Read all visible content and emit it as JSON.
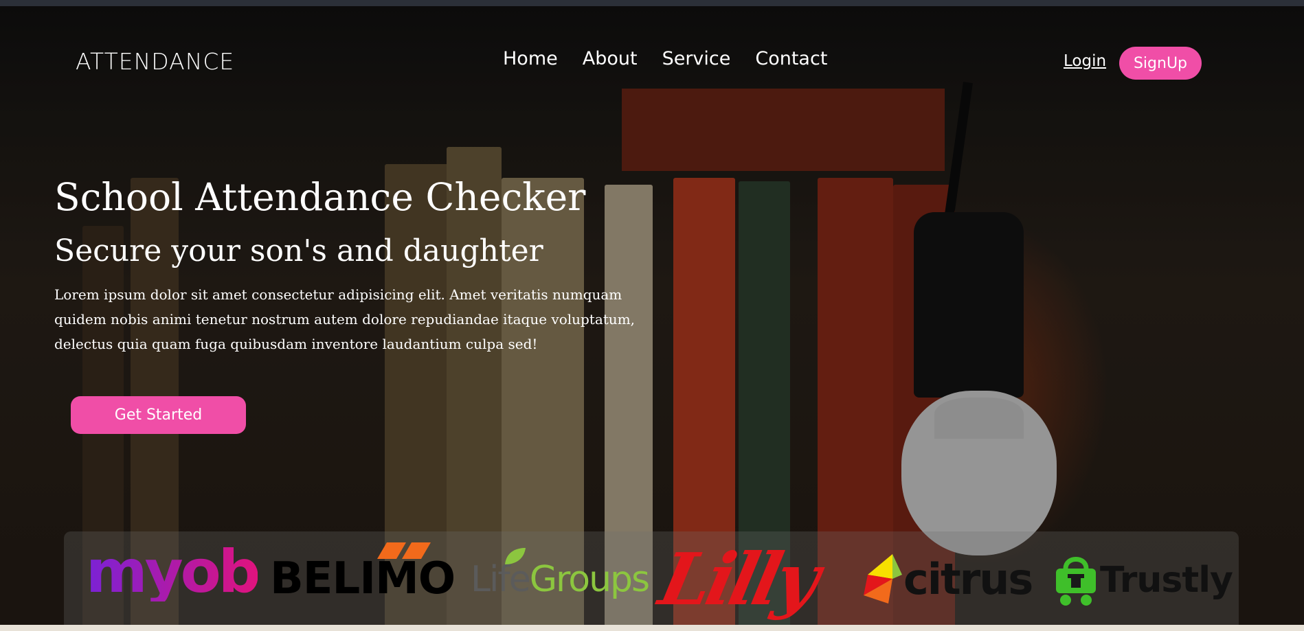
{
  "brand": "ATTENDANCE",
  "nav": {
    "links": [
      "Home",
      "About",
      "Service",
      "Contact"
    ],
    "login": "Login",
    "signup": "SignUp"
  },
  "hero": {
    "title": "School Attendance Checker",
    "subtitle": "Secure your son's and daughter",
    "text": "Lorem ipsum dolor sit amet consectetur adipisicing elit. Amet veritatis numquam quidem nobis animi tenetur nostrum autem dolore repudiandae itaque voluptatum, delectus quia quam fuga quibusdam inventore laudantium culpa sed!",
    "cta": "Get Started"
  },
  "logos": {
    "myob": "myob",
    "belimo": "BELIMO",
    "lifegroups_life": "Life",
    "lifegroups_groups": "Groups",
    "lilly": "Lilly",
    "citrus": "citrus",
    "trustly": "Trustly"
  },
  "colors": {
    "accent": "#f04ea7",
    "myob": "#8a1fd0",
    "lifegroups": "#8cc63f",
    "lilly": "#e3161b",
    "trustly": "#3fbf2a"
  }
}
